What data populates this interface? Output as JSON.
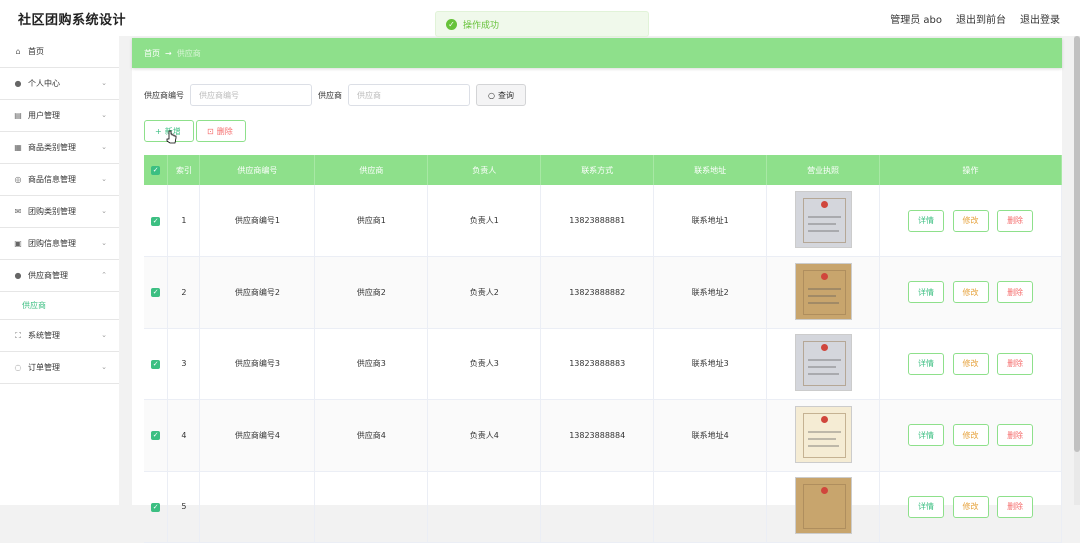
{
  "app": {
    "title": "社区团购系统设计"
  },
  "header": {
    "user": "管理员 abo",
    "front": "退出到前台",
    "logout": "退出登录"
  },
  "toast": {
    "text": "操作成功"
  },
  "sidebar": {
    "items": [
      {
        "label": "首页",
        "icon": "home-icon"
      },
      {
        "label": "个人中心",
        "icon": "user-icon"
      },
      {
        "label": "用户管理",
        "icon": "users-icon"
      },
      {
        "label": "商品类别管理",
        "icon": "category-icon"
      },
      {
        "label": "商品信息管理",
        "icon": "goods-icon"
      },
      {
        "label": "团购类别管理",
        "icon": "mail-icon"
      },
      {
        "label": "团购信息管理",
        "icon": "doc-icon"
      },
      {
        "label": "供应商管理",
        "icon": "supplier-icon"
      },
      {
        "label": "系统管理",
        "icon": "system-icon"
      },
      {
        "label": "订单管理",
        "icon": "order-icon"
      }
    ],
    "sub_item": "供应商"
  },
  "breadcrumb": {
    "home": "首页",
    "current": "供应商"
  },
  "search": {
    "code_label": "供应商编号",
    "code_placeholder": "供应商编号",
    "name_label": "供应商",
    "name_placeholder": "供应商",
    "button": "查询"
  },
  "actions": {
    "add": "新增",
    "delete": "删除"
  },
  "table": {
    "headers": [
      "索引",
      "供应商编号",
      "供应商",
      "负责人",
      "联系方式",
      "联系地址",
      "营业执照",
      "操作"
    ],
    "rows": [
      {
        "index": "1",
        "code": "供应商编号1",
        "name": "供应商1",
        "owner": "负责人1",
        "phone": "13823888881",
        "address": "联系地址1"
      },
      {
        "index": "2",
        "code": "供应商编号2",
        "name": "供应商2",
        "owner": "负责人2",
        "phone": "13823888882",
        "address": "联系地址2"
      },
      {
        "index": "3",
        "code": "供应商编号3",
        "name": "供应商3",
        "owner": "负责人3",
        "phone": "13823888883",
        "address": "联系地址3"
      },
      {
        "index": "4",
        "code": "供应商编号4",
        "name": "供应商4",
        "owner": "负责人4",
        "phone": "13823888884",
        "address": "联系地址4"
      },
      {
        "index": "5",
        "code": "",
        "name": "",
        "owner": "",
        "phone": "",
        "address": ""
      }
    ],
    "ops": {
      "detail": "详情",
      "edit": "修改",
      "remove": "删除"
    }
  },
  "colors": {
    "accent": "#8ee08b",
    "primary": "#3cbf82",
    "danger": "#f56c6c",
    "warning": "#e6a23c"
  }
}
